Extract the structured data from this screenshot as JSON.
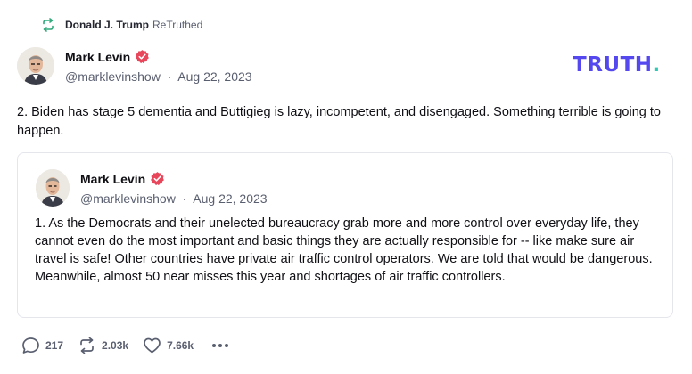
{
  "retruth": {
    "user": "Donald J. Trump",
    "label": "ReTruthed"
  },
  "post": {
    "author_name": "Mark Levin",
    "handle": "@marklevinshow",
    "date": "Aug 22, 2023",
    "separator": "·",
    "text": "2. Biden has stage 5 dementia and Buttigieg is lazy, incompetent, and disengaged.  Something terrible is going to happen."
  },
  "brand": {
    "wordmark": "TRUTH",
    "dot": ".",
    "color": "#5448ee",
    "dot_color": "#2ec9b5"
  },
  "quote": {
    "author_name": "Mark Levin",
    "handle": "@marklevinshow",
    "date": "Aug 22, 2023",
    "separator": "·",
    "text": "1. As the Democrats and their unelected bureaucracy grab more and more control over everyday life, they cannot even do the most important and basic things they are actually responsible for -- like make sure air travel is safe!  Other countries have private air traffic control operators.  We are told that would be dangerous.  Meanwhile, almost 50 near misses this year and shortages of air traffic controllers."
  },
  "actions": {
    "replies": "217",
    "retruths": "2.03k",
    "likes": "7.66k"
  },
  "icons": {
    "retruth": "retruth-icon",
    "verified": "verified-badge-icon",
    "reply": "reply-icon",
    "like": "heart-icon",
    "more": "more-icon"
  },
  "colors": {
    "retruth_green": "#2fa87a",
    "verified_red": "#e8465a",
    "muted": "#5a5f70"
  }
}
